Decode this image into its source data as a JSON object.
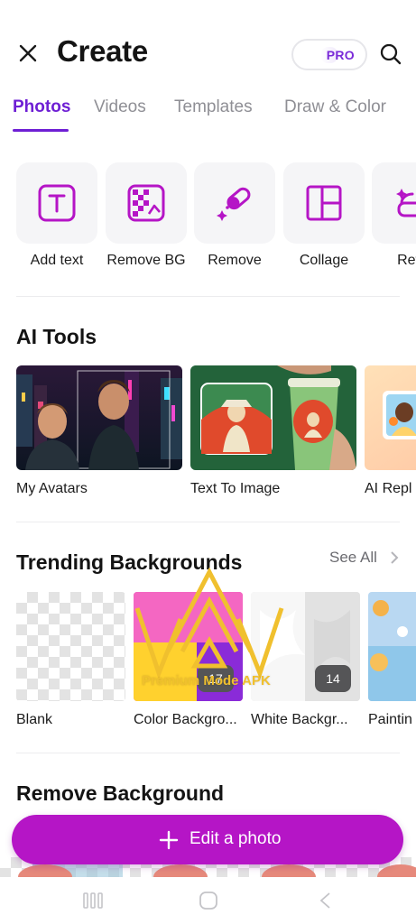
{
  "header": {
    "title": "Create",
    "pro_label": "PRO",
    "close_icon": "close-icon",
    "search_icon": "search-icon"
  },
  "tabs": [
    {
      "label": "Photos",
      "active": true
    },
    {
      "label": "Videos",
      "active": false
    },
    {
      "label": "Templates",
      "active": false
    },
    {
      "label": "Draw & Color",
      "active": false
    }
  ],
  "tools": [
    {
      "label": "Add text",
      "icon": "text-box-icon"
    },
    {
      "label": "Remove BG",
      "icon": "remove-bg-icon"
    },
    {
      "label": "Remove",
      "icon": "eraser-icon"
    },
    {
      "label": "Collage",
      "icon": "collage-icon"
    },
    {
      "label": "Reto",
      "icon": "retouch-icon"
    }
  ],
  "ai_tools": {
    "title": "AI Tools",
    "items": [
      {
        "label": "My Avatars"
      },
      {
        "label": "Text To Image"
      },
      {
        "label": "AI Repl"
      }
    ]
  },
  "trending": {
    "title": "Trending Backgrounds",
    "see_all": "See All",
    "items": [
      {
        "label": "Blank"
      },
      {
        "label": "Color Backgro...",
        "count": "17"
      },
      {
        "label": "White Backgr...",
        "count": "14"
      },
      {
        "label": "Paintin"
      }
    ]
  },
  "remove_background": {
    "title": "Remove Background"
  },
  "cta": {
    "label": "Edit a photo",
    "icon": "plus-icon"
  },
  "watermark": {
    "text": "Premium Mode APK"
  },
  "colors": {
    "accent": "#6e1fd4",
    "cta": "#b515c6",
    "tool_icon": "#b515c6",
    "watermark": "#f0c02e"
  }
}
